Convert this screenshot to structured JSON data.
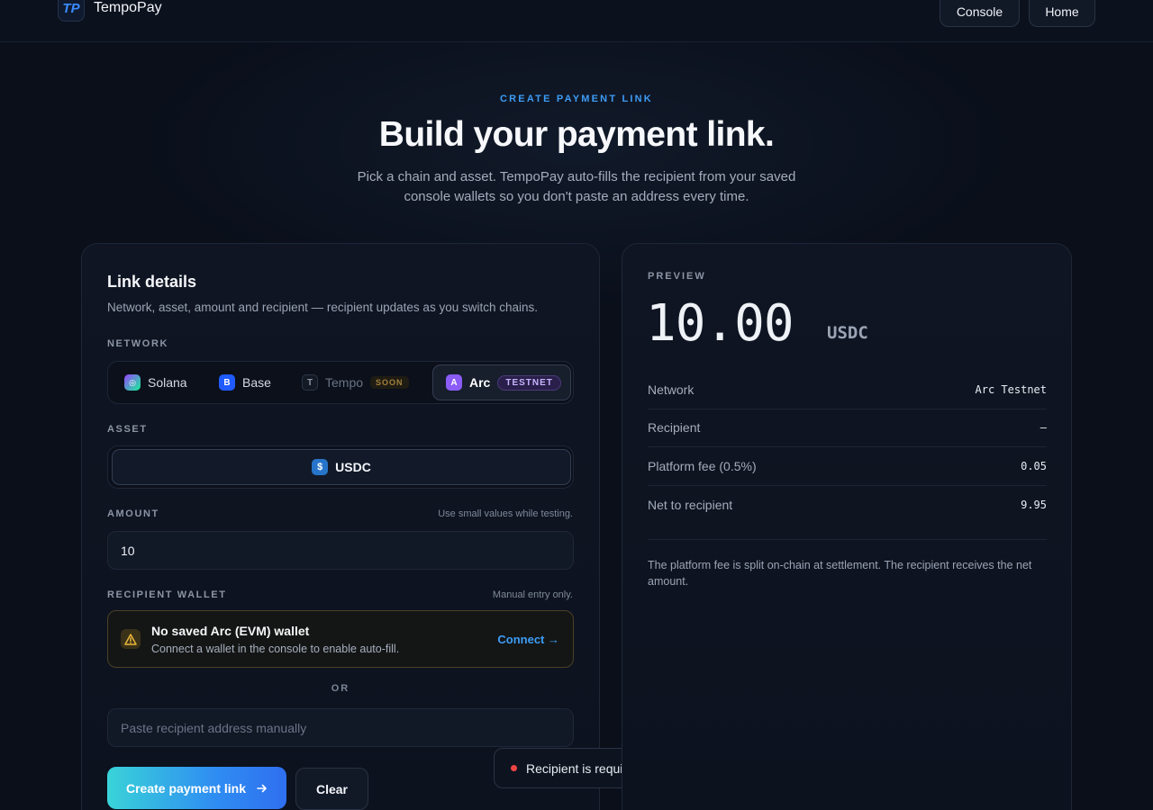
{
  "header": {
    "logo_text": "TP",
    "brand": "TempoPay",
    "console_label": "Console",
    "home_label": "Home"
  },
  "hero": {
    "eyebrow": "CREATE PAYMENT LINK",
    "title": "Build your payment link.",
    "subtitle_line1": "Pick a chain and asset. TempoPay auto-fills the recipient from your saved",
    "subtitle_line2": "console wallets so you don't paste an address every time."
  },
  "form": {
    "title": "Link details",
    "description": "Network, asset, amount and recipient — recipient updates as you switch chains.",
    "network_label": "NETWORK",
    "networks": [
      {
        "name": "Solana",
        "icon": "solana-icon",
        "glyph": "◎",
        "badge": "",
        "state": "available"
      },
      {
        "name": "Base",
        "icon": "base-icon",
        "glyph": "B",
        "badge": "",
        "state": "available"
      },
      {
        "name": "Tempo",
        "icon": "tempo-icon",
        "glyph": "T",
        "badge": "SOON",
        "state": "disabled"
      },
      {
        "name": "Arc",
        "icon": "arc-icon",
        "glyph": "A",
        "badge": "TESTNET",
        "state": "selected"
      }
    ],
    "asset_label": "ASSET",
    "asset": {
      "name": "USDC",
      "icon": "usdc-icon",
      "glyph": "$"
    },
    "amount_label": "AMOUNT",
    "amount_hint": "Use small values while testing.",
    "amount_value": "10",
    "recipient_label": "RECIPIENT WALLET",
    "recipient_hint": "Manual entry only.",
    "warning": {
      "title": "No saved Arc (EVM) wallet",
      "message": "Connect a wallet in the console to enable auto-fill.",
      "action": "Connect →",
      "color": "#e8b53a"
    },
    "or_label": "OR",
    "recipient_placeholder": "Paste recipient address manually",
    "recipient_value": "",
    "create_label": "Create payment link",
    "clear_label": "Clear"
  },
  "toast": {
    "message": "Recipient is required.",
    "status_color": "#ef4444"
  },
  "preview": {
    "label": "PREVIEW",
    "amount": "10.00",
    "currency": "USDC",
    "rows": [
      {
        "label": "Network",
        "value": "Arc Testnet"
      },
      {
        "label": "Recipient",
        "value": "—"
      },
      {
        "label": "Platform fee (0.5%)",
        "value": "0.05"
      },
      {
        "label": "Net to recipient",
        "value": "9.95"
      }
    ],
    "note": "The platform fee is split on-chain at settlement. The recipient receives the net amount."
  },
  "colors": {
    "accent": "#3d9cf5",
    "background": "#0a0f1a",
    "selected_chain": "#8b5cf6"
  }
}
